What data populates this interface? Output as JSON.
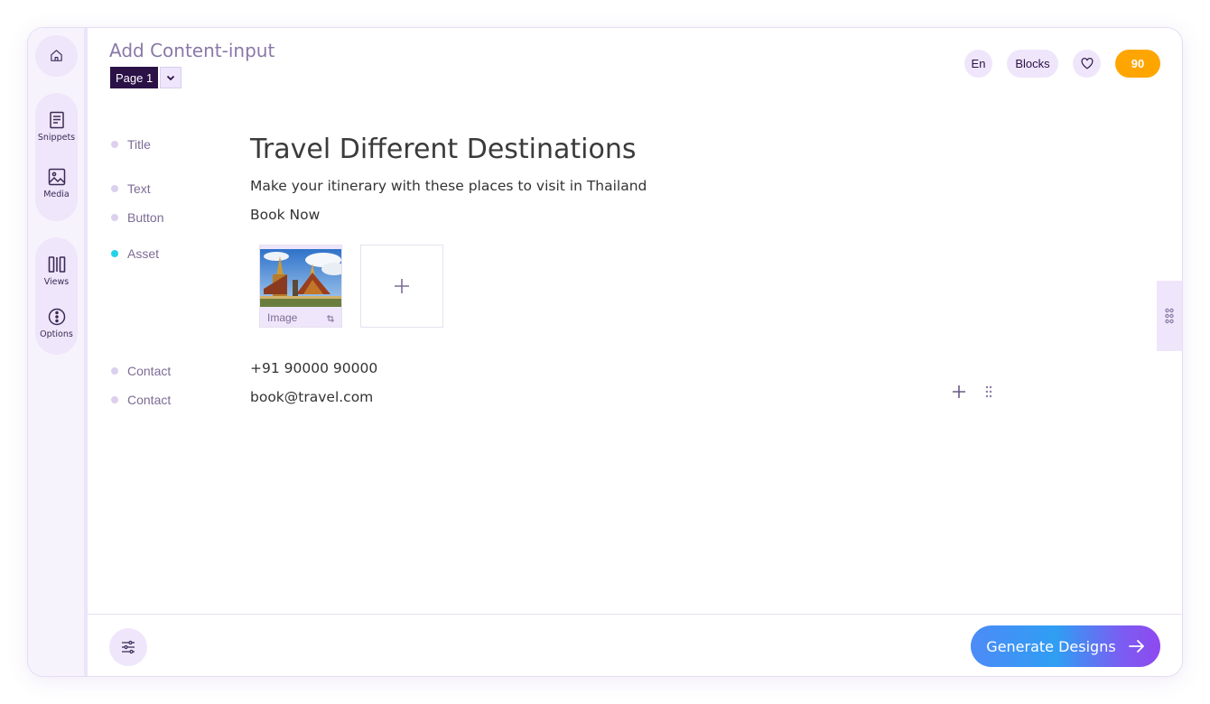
{
  "header": {
    "title": "Add Content-input",
    "page_select": {
      "value": "Page 1"
    }
  },
  "top_right": {
    "language": "En",
    "blocks_label": "Blocks",
    "credits": "90"
  },
  "sidebar": {
    "items": [
      {
        "label": "",
        "icon": "home-icon"
      },
      {
        "label": "Snippets",
        "icon": "snippets-icon"
      },
      {
        "label": "Media",
        "icon": "media-icon"
      },
      {
        "label": "Views",
        "icon": "views-icon"
      },
      {
        "label": "Options",
        "icon": "options-icon"
      }
    ]
  },
  "fields": {
    "title": {
      "label": "Title",
      "value": "Travel Different Destinations"
    },
    "text": {
      "label": "Text",
      "value": "Make your itinerary with these places to visit in Thailand"
    },
    "button": {
      "label": "Button",
      "value": "Book Now"
    },
    "asset": {
      "label": "Asset",
      "image_caption": "Image"
    },
    "contact_phone": {
      "label": "Contact",
      "value": "+91 90000 90000"
    },
    "contact_email": {
      "label": "Contact",
      "value": "book@travel.com"
    }
  },
  "footer": {
    "generate_label": "Generate Designs"
  },
  "colors": {
    "accent_purple": "#2a1146",
    "credits_orange": "#ffa500",
    "pill_bg": "#efe6fb",
    "asset_dot": "#22d3e8"
  }
}
